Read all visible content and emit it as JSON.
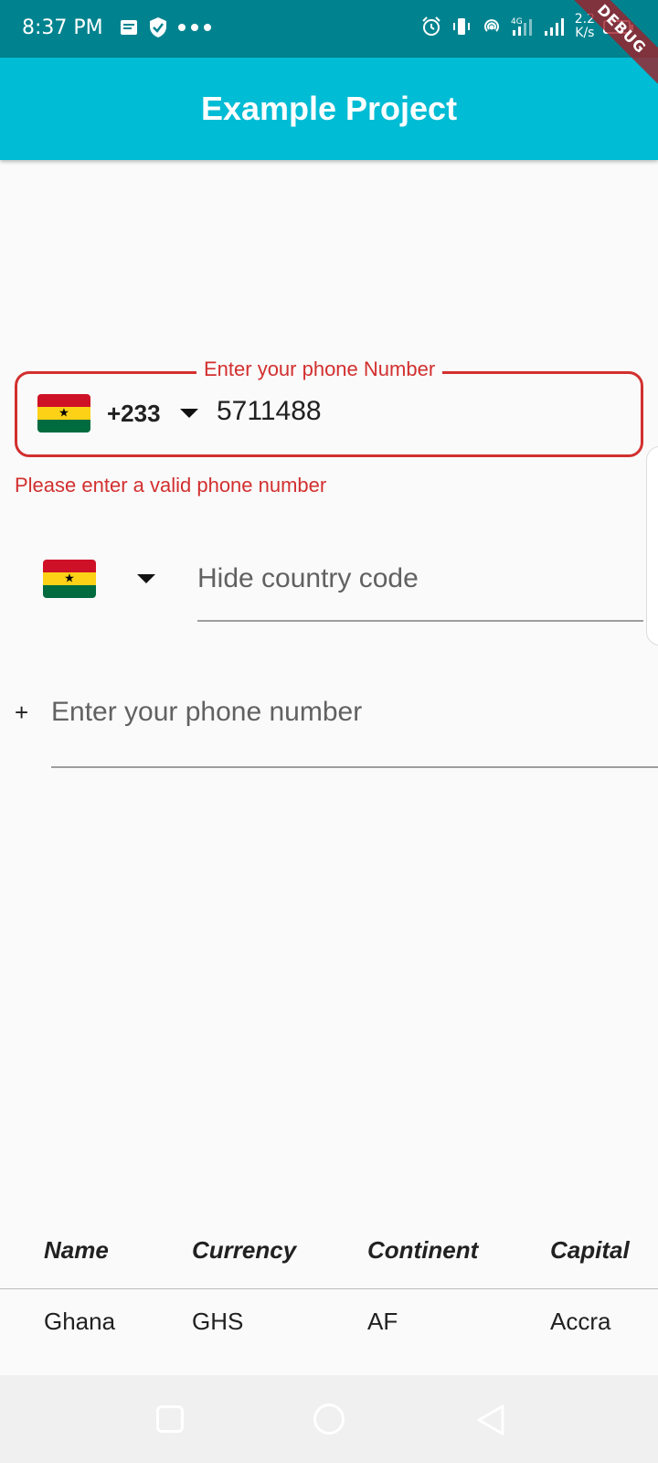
{
  "status_bar": {
    "time": "8:37 PM",
    "left_icons": [
      "notes-icon",
      "shield-check-icon",
      "more-dots-icon"
    ],
    "right_icons": [
      "alarm-icon",
      "vibrate-icon",
      "hotspot-icon",
      "signal-4g-icon",
      "signal-icon",
      "battery-icon"
    ],
    "speed_value": "2.2",
    "speed_unit": "K/s"
  },
  "debug_banner": "DEBUG",
  "app_bar": {
    "title": "Example Project"
  },
  "phone_field": {
    "label": "Enter your phone Number",
    "flag": "ghana-flag",
    "dial_code": "+233",
    "value": "5711488",
    "error": "Please enter a valid phone number"
  },
  "hide_code_field": {
    "flag": "ghana-flag",
    "placeholder": "Hide country code"
  },
  "plain_field": {
    "prefix": "+",
    "placeholder": "Enter your phone number"
  },
  "table": {
    "headers": [
      "Name",
      "Currency",
      "Continent",
      "Capital"
    ],
    "rows": [
      [
        "Ghana",
        "GHS",
        "AF",
        "Accra"
      ]
    ]
  },
  "colors": {
    "status_bar": "#00838f",
    "app_bar": "#00bcd4",
    "error": "#d32f2f"
  }
}
